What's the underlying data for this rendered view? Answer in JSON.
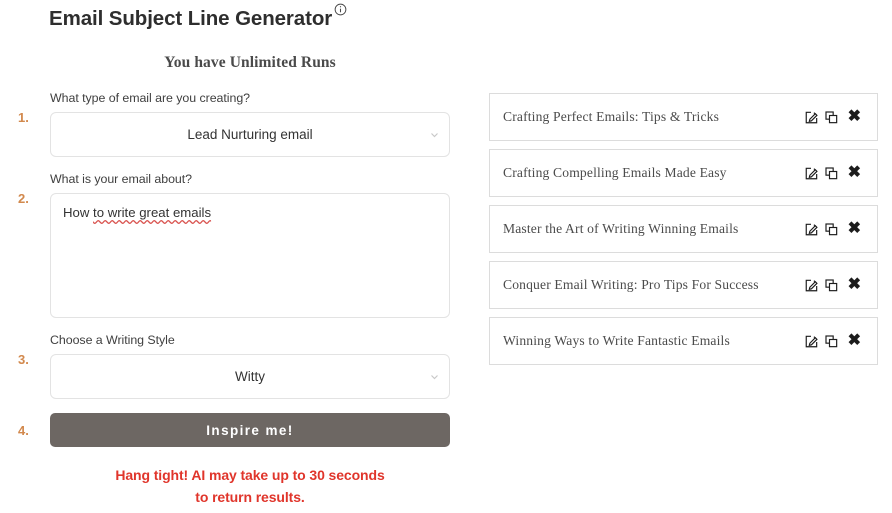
{
  "header": {
    "title": "Email Subject Line Generator",
    "info_icon": "info-circle-icon",
    "runs_banner": "You have Unlimited Runs"
  },
  "form": {
    "steps": [
      "1.",
      "2.",
      "3.",
      "4."
    ],
    "email_type": {
      "label": "What type of email are you creating?",
      "value": "Lead Nurturing email",
      "chevron": "chevron-down-icon"
    },
    "email_about": {
      "label": "What is your email about?",
      "value": "How to write great emails",
      "value_ok": "How ",
      "value_misspelled": "to write great emails",
      "placeholder": ""
    },
    "writing_style": {
      "label": "Choose a Writing Style",
      "value": "Witty",
      "chevron": "chevron-down-icon"
    },
    "submit_label": "Inspire me!",
    "notice_line1": "Hang tight! AI may take up to 30 seconds",
    "notice_line2": "to return results."
  },
  "results": {
    "items": [
      {
        "text": "Crafting Perfect Emails: Tips & Tricks"
      },
      {
        "text": "Crafting Compelling Emails Made Easy"
      },
      {
        "text": "Master the Art of Writing Winning Emails"
      },
      {
        "text": "Conquer Email Writing: Pro Tips For Success"
      },
      {
        "text": "Winning Ways to Write Fantastic Emails"
      }
    ],
    "actions": {
      "edit": "edit-pencil-icon",
      "copy": "copy-icon",
      "close": "close-x-icon",
      "close_glyph": "✖"
    }
  },
  "colors": {
    "step_number": "#d2894d",
    "button_bg": "#6d6763",
    "notice": "#e0352b",
    "border": "#e3e3e3",
    "card_border": "#dcdcdc",
    "spellcheck_underline": "#d9534f"
  }
}
